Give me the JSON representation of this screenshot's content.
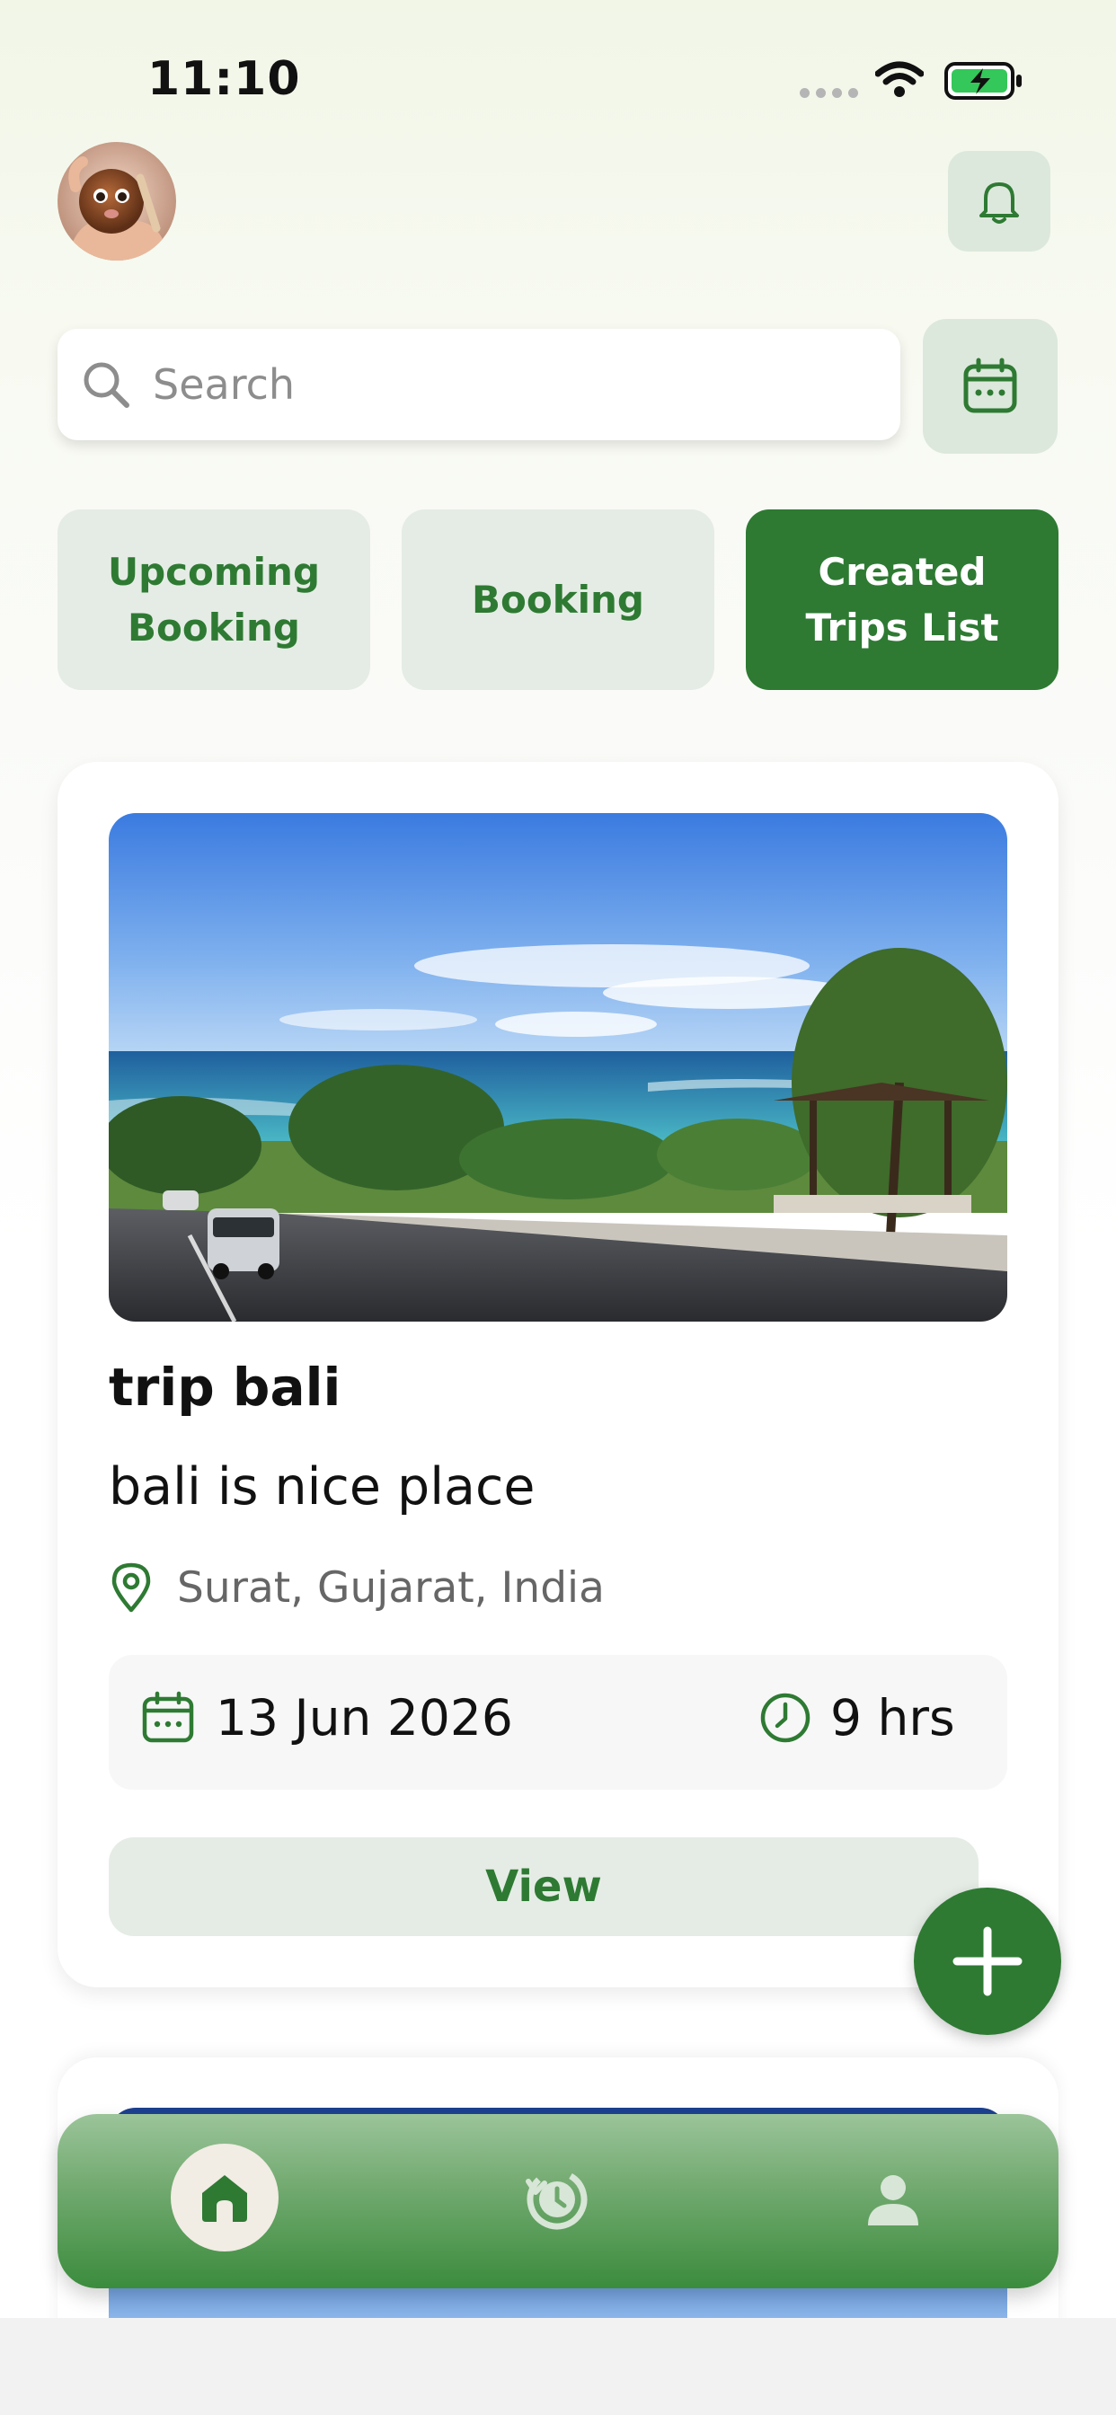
{
  "status_bar": {
    "time": "11:10"
  },
  "search": {
    "placeholder": "Search"
  },
  "tabs": [
    {
      "label": "Upcoming\nBooking",
      "active": false
    },
    {
      "label": "Booking",
      "active": false
    },
    {
      "label": "Created\nTrips List",
      "active": true
    }
  ],
  "trips": [
    {
      "title": "trip bali",
      "description": "bali is nice place",
      "location": "Surat, Gujarat, India",
      "date": "13 Jun 2026",
      "duration": "9 hrs",
      "view_label": "View"
    }
  ],
  "icons": {
    "avatar": "avatar",
    "notifications": "bell-icon",
    "calendar_button": "calendar-icon",
    "search": "search-icon",
    "location": "map-pin-icon",
    "date": "calendar-icon",
    "duration": "clock-icon",
    "add": "plus-icon",
    "nav": [
      "home-icon",
      "history-icon",
      "profile-icon"
    ]
  },
  "colors": {
    "accent": "#2e7a33",
    "accent_light": "#e5ece5",
    "nav_gradient_top": "#9bc49a",
    "nav_gradient_bottom": "#3b8c3d"
  }
}
